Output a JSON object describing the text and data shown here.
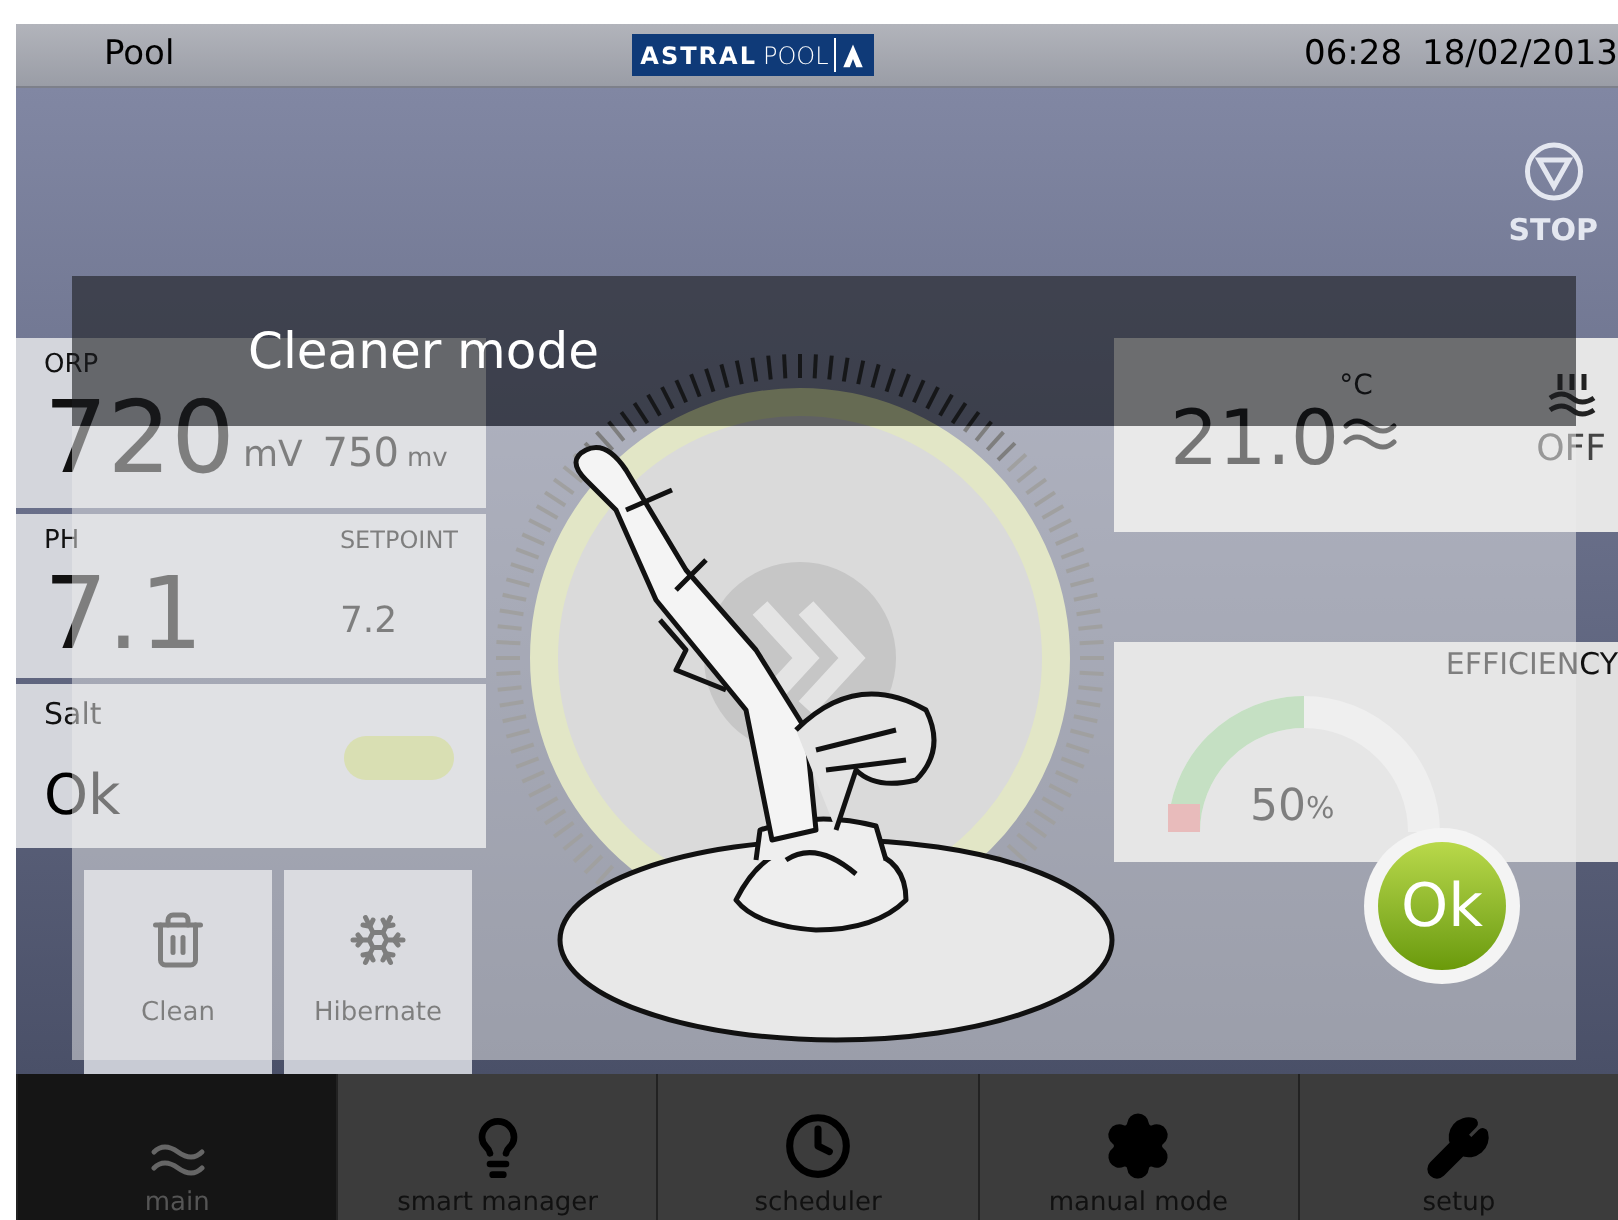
{
  "status_bar": {
    "location": "Pool",
    "logo_bold": "ASTRAL",
    "logo_light": "POOL",
    "time": "06:28",
    "date": "18/02/2013"
  },
  "stop_button": {
    "label": "STOP"
  },
  "dashboard": {
    "orp": {
      "label": "ORP",
      "value": "720",
      "unit": "mV",
      "setpoint": "750",
      "setpoint_unit": "mv"
    },
    "ph": {
      "label": "PH",
      "value": "7.1",
      "setpoint_label": "SETPOINT",
      "setpoint": "7.2"
    },
    "salt": {
      "label": "Salt",
      "value": "Ok"
    },
    "temperature": {
      "value": "21.0",
      "unit": "°C"
    },
    "heater": {
      "status": "OFF"
    },
    "efficiency": {
      "label": "EFFICIENCY",
      "value": "50",
      "unit": "%",
      "level": 0.5
    },
    "modes": [
      {
        "label": "Clean",
        "kind": "clean"
      },
      {
        "label": "Hibernate",
        "kind": "hibernate"
      }
    ]
  },
  "dialog": {
    "title": "Cleaner mode",
    "ok_button": "Ok"
  },
  "nav": [
    {
      "label": "main",
      "kind": "waves",
      "selected": true
    },
    {
      "label": "smart manager",
      "kind": "bulb",
      "selected": false
    },
    {
      "label": "scheduler",
      "kind": "clock",
      "selected": false
    },
    {
      "label": "manual mode",
      "kind": "gear",
      "selected": false
    },
    {
      "label": "setup",
      "kind": "wrench",
      "selected": false
    }
  ]
}
